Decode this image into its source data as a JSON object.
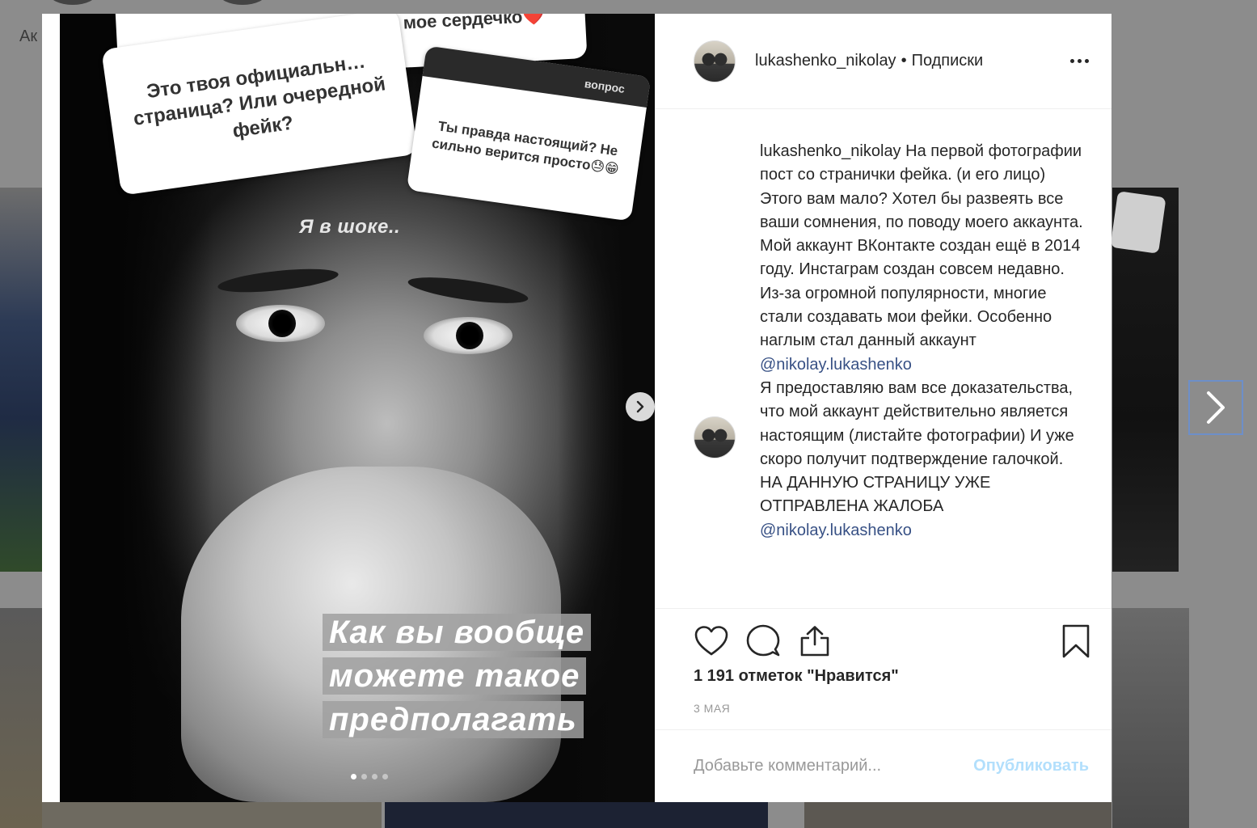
{
  "background": {
    "label": "Ак"
  },
  "post": {
    "author": "lukashenko_nikolay",
    "header_separator": "•",
    "follow_label": "Подписки",
    "story": {
      "heart_bubble": "…ое мое сердечко❤️",
      "question_one": "Это твоя официальн… страница? Или очередной фейк?",
      "question_two_header": "вопрос",
      "question_two": "Ты правда настоящий? Не сильно верится просто😓😁",
      "shock_text": "Я в шоке..",
      "caption_lines": [
        "Как вы вообще",
        "можете такое",
        "предполагать"
      ]
    },
    "caption": {
      "username": "lukashenko_nikolay",
      "text_part1": " На первой фотографии пост со странички фейка. (и его лицо) Этого вам мало? Хотел бы развеять все ваши сомнения, по поводу моего аккаунта. Мой аккаунт ВКонтакте создан ещё в 2014 году. Инстаграм создан совсем недавно. Из-за огромной популярности, многие стали создавать мои фейки. Особенно наглым стал данный аккаунт ",
      "mention1": "@nikolay.lukashenko",
      "text_part2": "\nЯ предоставляю вам все доказательства, что мой аккаунт действительно является настоящим (листайте фотографии) И уже скоро получит подтверждение галочкой.\nНА ДАННУЮ СТРАНИЦУ УЖЕ ОТПРАВЛЕНА ЖАЛОБА\n",
      "mention2": "@nikolay.lukashenko"
    },
    "likes": "1 191 отметок \"Нравится\"",
    "date": "3 МАЯ",
    "comment_placeholder": "Добавьте комментарий...",
    "publish_label": "Опубликовать",
    "slides": 4,
    "active_slide": 1
  },
  "icons": {
    "like": "heart-icon",
    "comment": "comment-icon",
    "share": "share-icon",
    "save": "bookmark-icon",
    "more": "more-icon",
    "next": "chevron-right-icon"
  },
  "colors": {
    "text": "#262626",
    "muted": "#999999",
    "link": "#385185",
    "publish_disabled": "#b2dffc",
    "overlay": "#8c8c8c"
  }
}
